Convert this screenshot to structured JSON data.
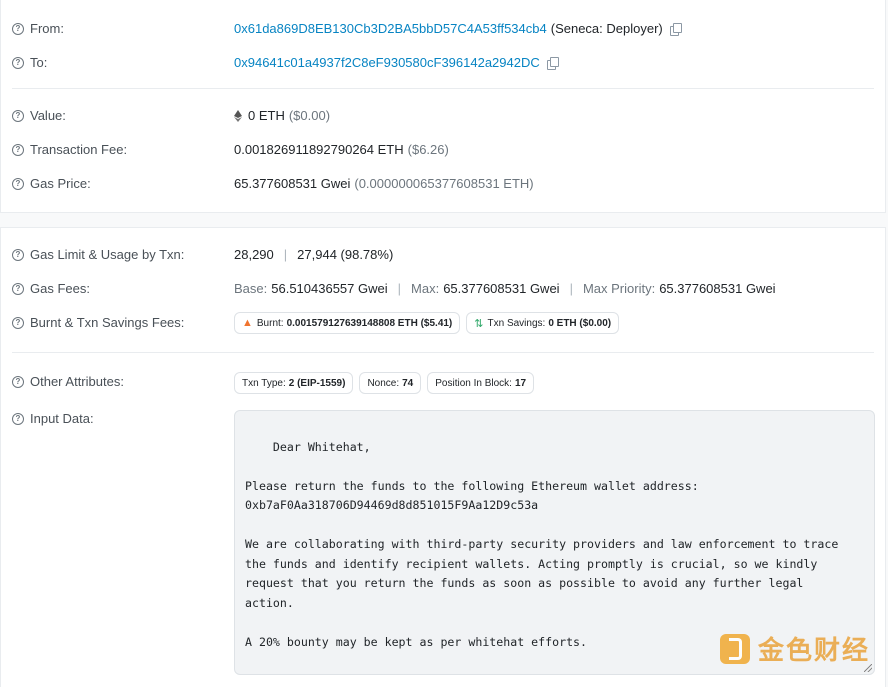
{
  "from": {
    "label": "From:",
    "address": "0x61da869D8EB130Cb3D2BA5bbD57C4A53ff534cb4",
    "tag": "(Seneca: Deployer)"
  },
  "to": {
    "label": "To:",
    "address": "0x94641c01a4937f2C8eF930580cF396142a2942DC"
  },
  "value": {
    "label": "Value:",
    "amount": "0 ETH",
    "usd": "($0.00)"
  },
  "transaction_fee": {
    "label": "Transaction Fee:",
    "amount": "0.001826911892790264 ETH",
    "usd": "($6.26)"
  },
  "gas_price": {
    "label": "Gas Price:",
    "gwei": "65.377608531 Gwei",
    "eth": "(0.000000065377608531 ETH)"
  },
  "gas_limit": {
    "label": "Gas Limit & Usage by Txn:",
    "limit": "28,290",
    "usage": "27,944 (98.78%)"
  },
  "gas_fees": {
    "label": "Gas Fees:",
    "base_label": "Base:",
    "base": "56.510436557 Gwei",
    "max_label": "Max:",
    "max": "65.377608531 Gwei",
    "priority_label": "Max Priority:",
    "priority": "65.377608531 Gwei"
  },
  "burnt": {
    "label": "Burnt & Txn Savings Fees:",
    "burnt_label": "Burnt:",
    "burnt_value": "0.001579127639148808 ETH ($5.41)",
    "savings_label": "Txn Savings:",
    "savings_value": "0 ETH ($0.00)"
  },
  "other": {
    "label": "Other Attributes:",
    "txn_type_label": "Txn Type:",
    "txn_type": "2 (EIP-1559)",
    "nonce_label": "Nonce:",
    "nonce": "74",
    "position_label": "Position In Block:",
    "position": "17"
  },
  "input": {
    "label": "Input Data:",
    "text": "Dear Whitehat,\n\nPlease return the funds to the following Ethereum wallet address:\n0xb7aF0Aa318706D94469d8d851015F9Aa12D9c53a\n\nWe are collaborating with third-party security providers and law enforcement to trace\nthe funds and identify recipient wallets. Acting promptly is crucial, so we kindly\nrequest that you return the funds as soon as possible to avoid any further legal\naction.\n\nA 20% bounty may be kept as per whitehat efforts."
  },
  "watermark": {
    "text": "金色财经"
  },
  "colors": {
    "link": "#0784c3",
    "accent_orange": "#f0a830",
    "savings_green": "#2fa86a"
  },
  "icons": [
    "help-circle-icon",
    "copy-icon",
    "eth-icon",
    "flame-icon",
    "savings-icon",
    "resize-grip-icon"
  ]
}
